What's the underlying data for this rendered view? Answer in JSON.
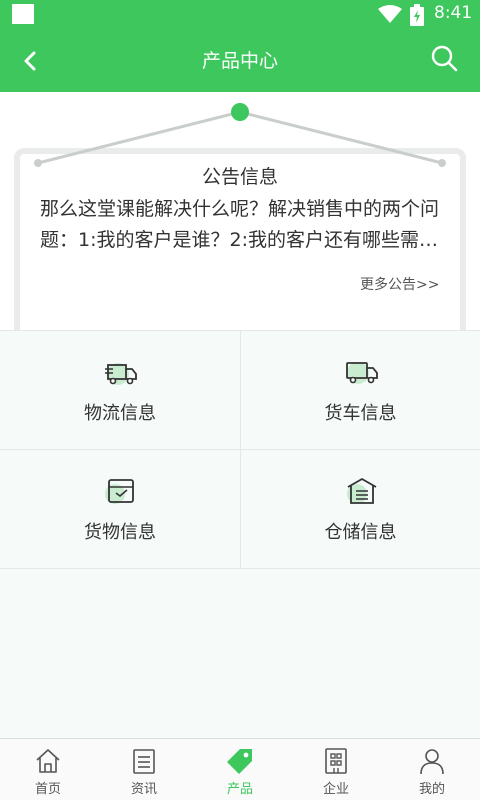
{
  "status_bar": {
    "time": "8:41"
  },
  "header": {
    "title": "产品中心"
  },
  "notice": {
    "title": "公告信息",
    "body": "那么这堂课能解决什么呢？解决销售中的两个问题：1:我的客户是谁？2:我的客户还有哪些需求？",
    "more_label": "更多公告>>"
  },
  "grid": {
    "items": [
      {
        "label": "物流信息",
        "icon": "logistics-truck-icon"
      },
      {
        "label": "货车信息",
        "icon": "truck-icon"
      },
      {
        "label": "货物信息",
        "icon": "cargo-box-icon"
      },
      {
        "label": "仓储信息",
        "icon": "warehouse-icon"
      }
    ]
  },
  "tabbar": {
    "items": [
      {
        "label": "首页",
        "icon": "home-icon"
      },
      {
        "label": "资讯",
        "icon": "news-icon"
      },
      {
        "label": "产品",
        "icon": "tag-icon"
      },
      {
        "label": "企业",
        "icon": "building-icon"
      },
      {
        "label": "我的",
        "icon": "user-icon"
      }
    ],
    "active": "产品"
  },
  "colors": {
    "brand": "#3dc75d",
    "text": "#333333"
  }
}
